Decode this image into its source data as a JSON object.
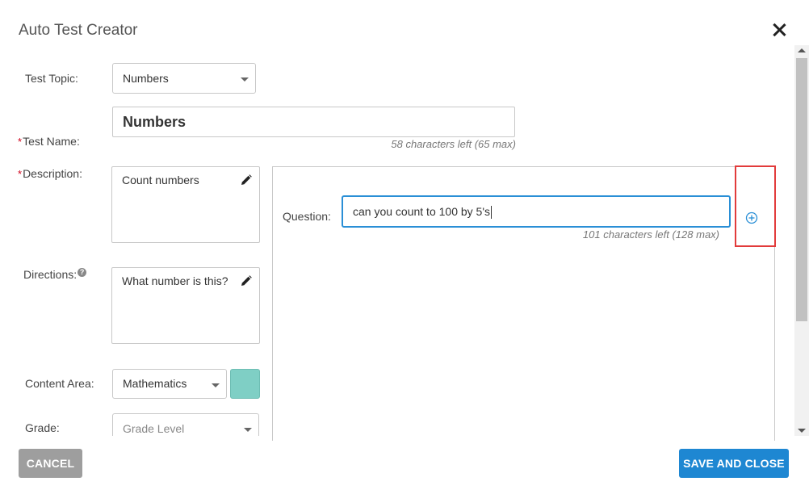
{
  "dialog": {
    "title": "Auto Test Creator"
  },
  "form": {
    "test_topic": {
      "label": "Test Topic:",
      "value": "Numbers"
    },
    "test_name": {
      "required_mark": "*",
      "label": "Test Name:",
      "value": "Numbers",
      "hint": "58 characters left (65 max)"
    },
    "description": {
      "required_mark": "*",
      "label": "Description:",
      "value": "Count numbers"
    },
    "directions": {
      "label": "Directions:",
      "help_icon": "?",
      "value": "What number is this?"
    },
    "content_area": {
      "label": "Content Area:",
      "value": "Mathematics",
      "swatch_color": "#7fcfc5"
    },
    "grade": {
      "label": "Grade:",
      "placeholder": "Grade Level"
    }
  },
  "question_panel": {
    "label": "Question:",
    "value": "can you count to 100 by 5's",
    "hint": "101 characters left (128 max)",
    "add_icon": "plus-circle-icon",
    "highlight_color": "#e23b3b"
  },
  "footer": {
    "cancel_label": "CANCEL",
    "save_label": "SAVE AND CLOSE"
  },
  "colors": {
    "accent": "#1e87d2",
    "cancel": "#9e9e9e",
    "focus_border": "#2a8fd6"
  }
}
